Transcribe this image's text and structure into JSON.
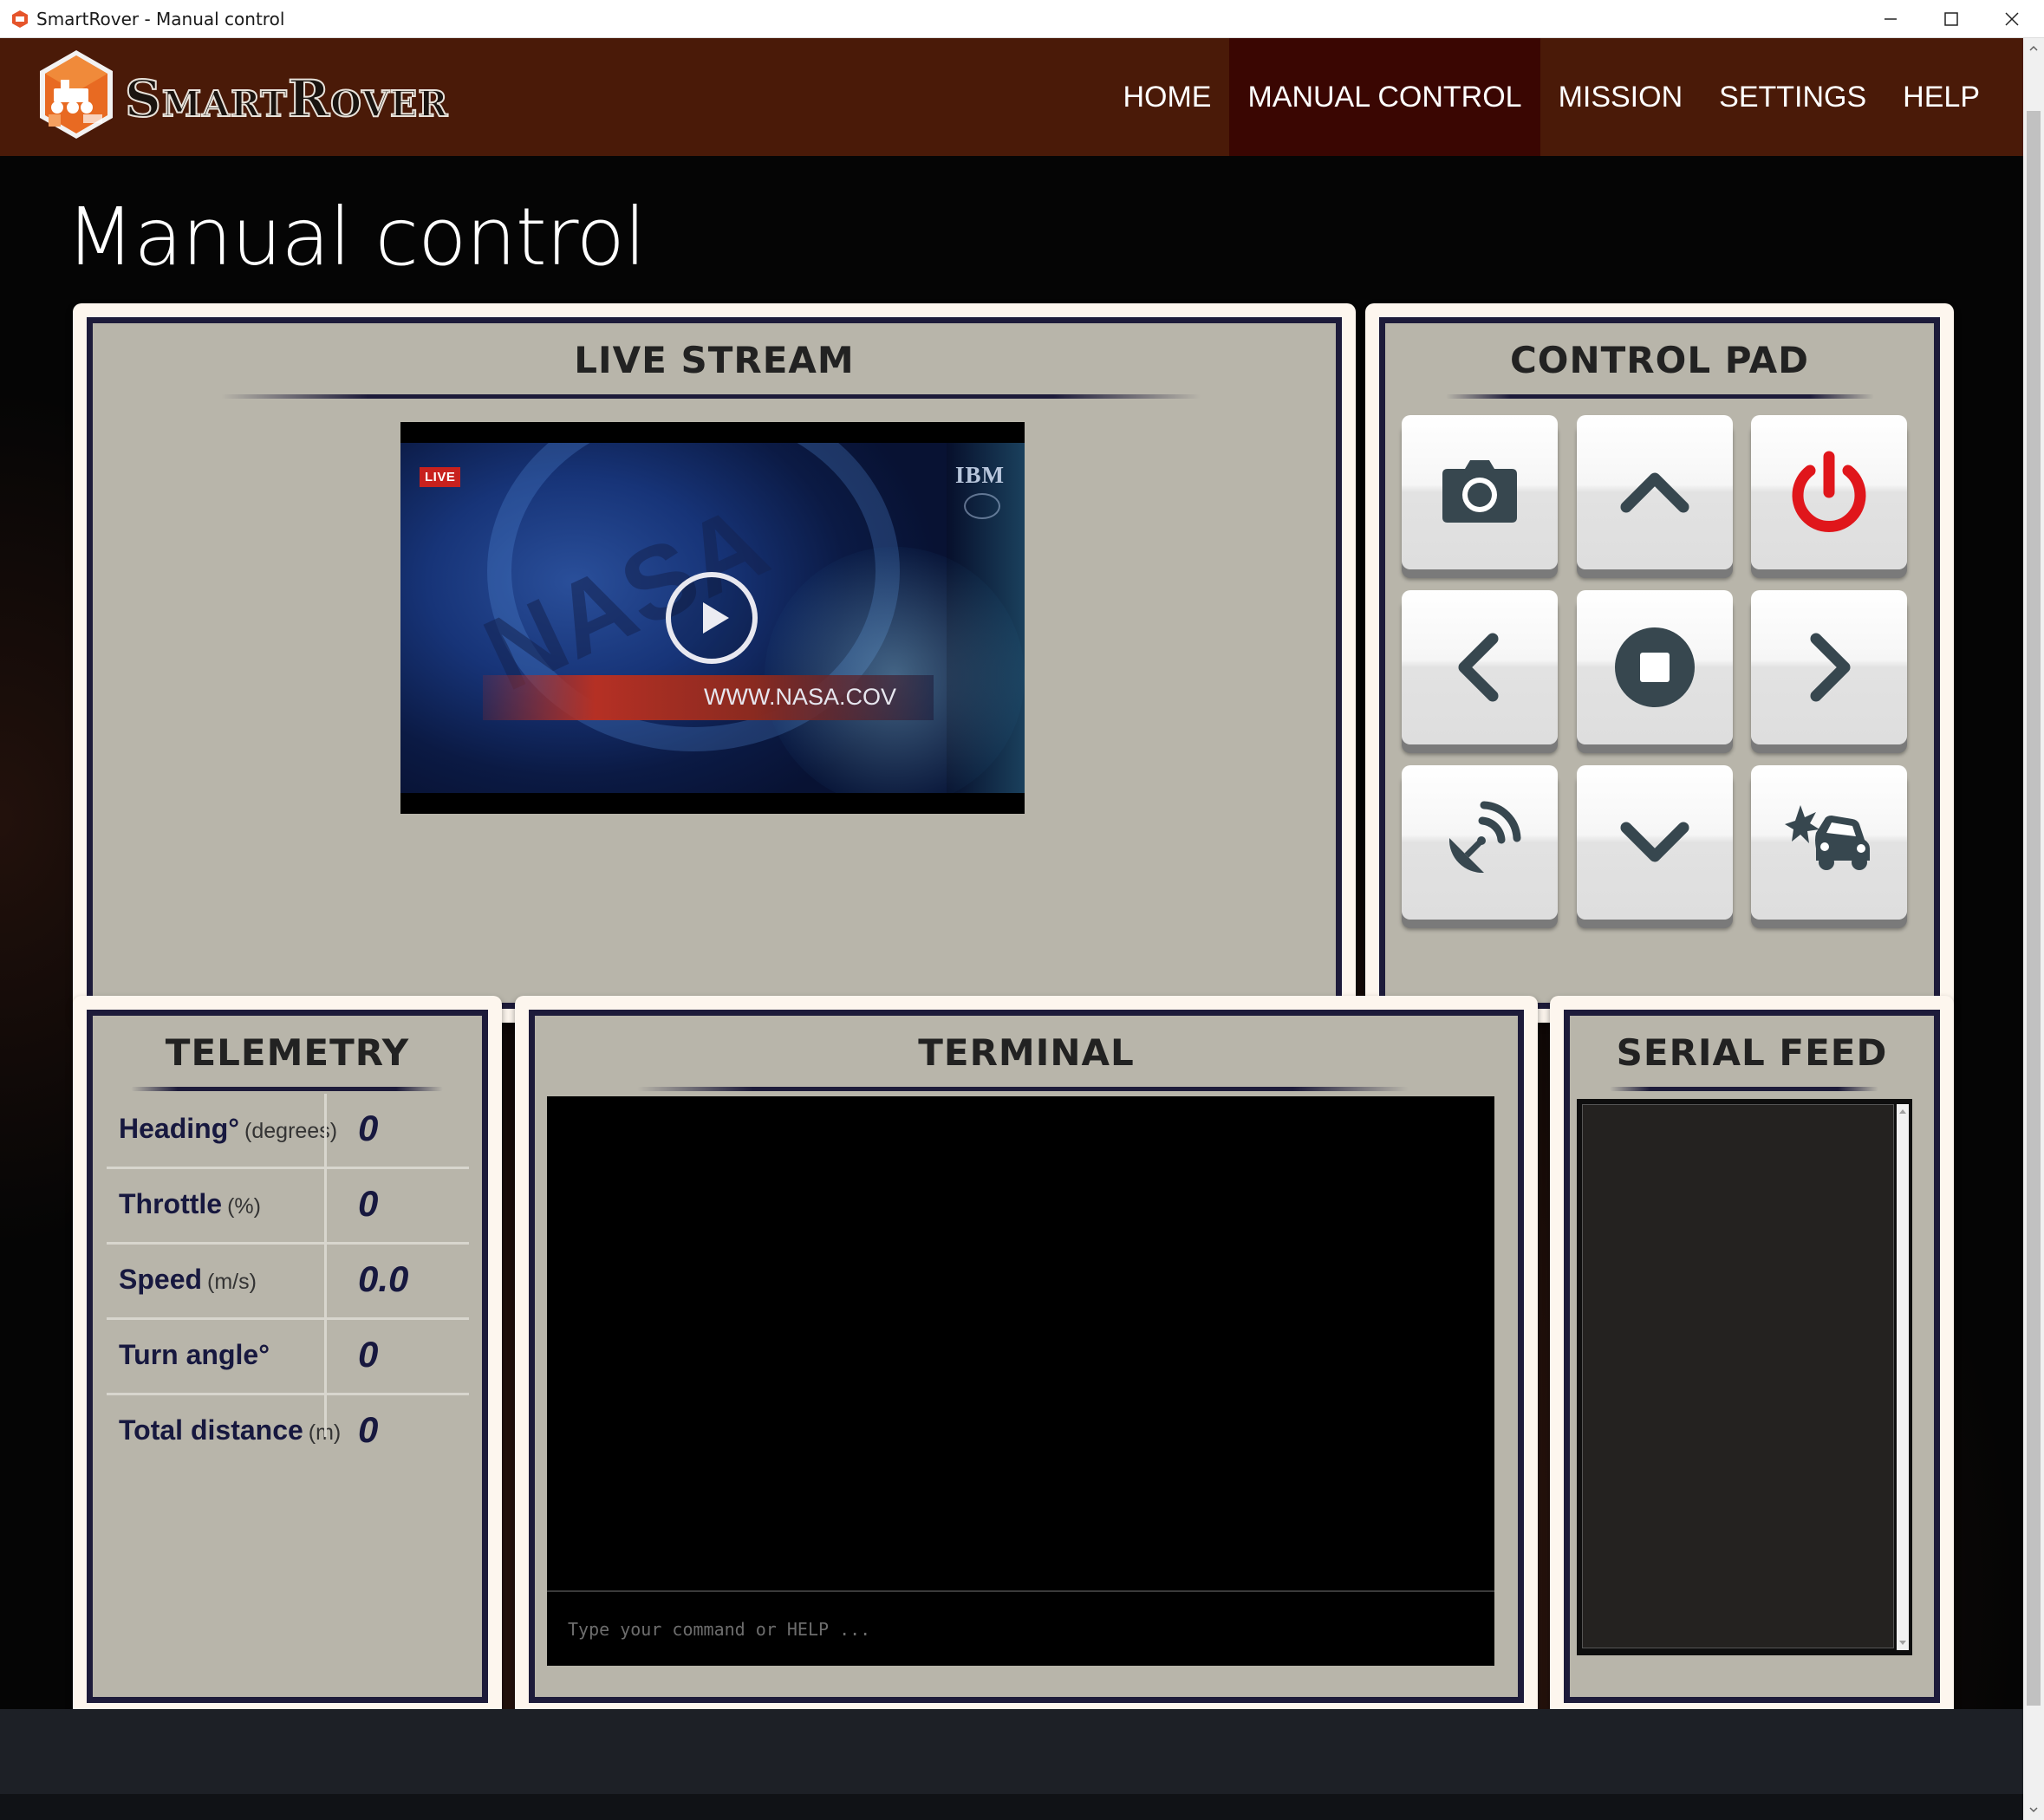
{
  "window": {
    "title": "SmartRover - Manual control",
    "buttons": [
      "minimize",
      "maximize",
      "close"
    ]
  },
  "navbar": {
    "brand": "SmartRover",
    "items": [
      {
        "label": "HOME",
        "active": false
      },
      {
        "label": "MANUAL CONTROL",
        "active": true
      },
      {
        "label": "MISSION",
        "active": false
      },
      {
        "label": "SETTINGS",
        "active": false
      },
      {
        "label": "HELP",
        "active": false
      }
    ]
  },
  "page": {
    "title": "Manual control"
  },
  "live_stream": {
    "title": "LIVE STREAM",
    "badge": "LIVE",
    "overlay_url": "WWW.NASA.COV",
    "overlay_brand": "IBM",
    "watermark": "NASA"
  },
  "control_pad": {
    "title": "CONTROL PAD",
    "buttons": [
      {
        "name": "camera",
        "icon": "camera-icon"
      },
      {
        "name": "forward",
        "icon": "chevron-up-icon"
      },
      {
        "name": "power",
        "icon": "power-icon",
        "color": "#e0161b"
      },
      {
        "name": "left",
        "icon": "chevron-left-icon"
      },
      {
        "name": "stop",
        "icon": "stop-icon"
      },
      {
        "name": "right",
        "icon": "chevron-right-icon"
      },
      {
        "name": "scan",
        "icon": "satellite-dish-icon"
      },
      {
        "name": "backward",
        "icon": "chevron-down-icon"
      },
      {
        "name": "collision",
        "icon": "car-crash-icon"
      }
    ]
  },
  "telemetry": {
    "title": "TELEMETRY",
    "rows": [
      {
        "label": "Heading°",
        "unit": "(degrees)",
        "value": "0"
      },
      {
        "label": "Throttle",
        "unit": "(%)",
        "value": "0"
      },
      {
        "label": "Speed",
        "unit": "(m/s)",
        "value": "0.0"
      },
      {
        "label": "Turn angle°",
        "unit": "",
        "value": "0"
      },
      {
        "label": "Total distance",
        "unit": "(m)",
        "value": "0"
      }
    ]
  },
  "terminal": {
    "title": "TERMINAL",
    "placeholder": "Type your command or HELP ..."
  },
  "serial_feed": {
    "title": "SERIAL FEED",
    "content": ""
  },
  "colors": {
    "navbar": "#4a1a08",
    "nav_active": "#3a0602",
    "panel_frame": "#1d1b3a",
    "panel_fill": "#b8b5aa",
    "telemetry_text": "#17183f",
    "power_red": "#e0161b"
  }
}
